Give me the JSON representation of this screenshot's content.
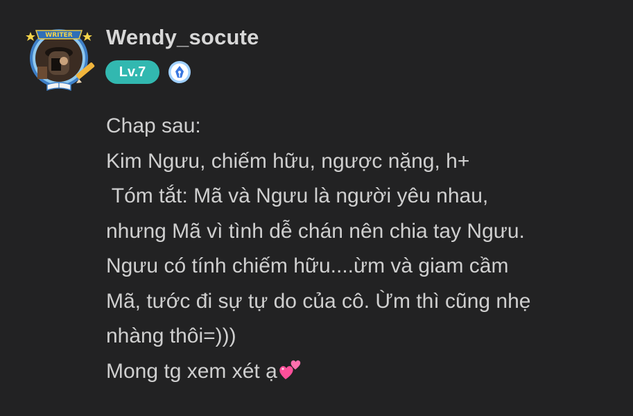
{
  "post": {
    "author": {
      "name": "Wendy_socute",
      "level": "Lv.7",
      "frame_label": "WRITER",
      "badge_icon": "fountain-pen-icon"
    },
    "body_lines": [
      "Chap sau:",
      "Kim Ngưu, chiếm hữu, ngược nặng, h+",
      " Tóm tắt: Mã và Ngưu là người yêu nhau,",
      "nhưng Mã vì tình dễ chán nên chia tay Ngưu.",
      "Ngưu có tính chiếm hữu....ừm và giam cầm",
      "Mã, tước đi sự tự do của cô. Ừm thì cũng nhẹ",
      "nhàng thôi=)))",
      "Mong tg xem xét ạ"
    ],
    "trailing_emoji": "two-hearts-icon"
  },
  "colors": {
    "background": "#222223",
    "text": "#cfcfcf",
    "username": "#d7d7d7",
    "level_badge": "#32b8b0",
    "heart": "#ff4f9a"
  }
}
